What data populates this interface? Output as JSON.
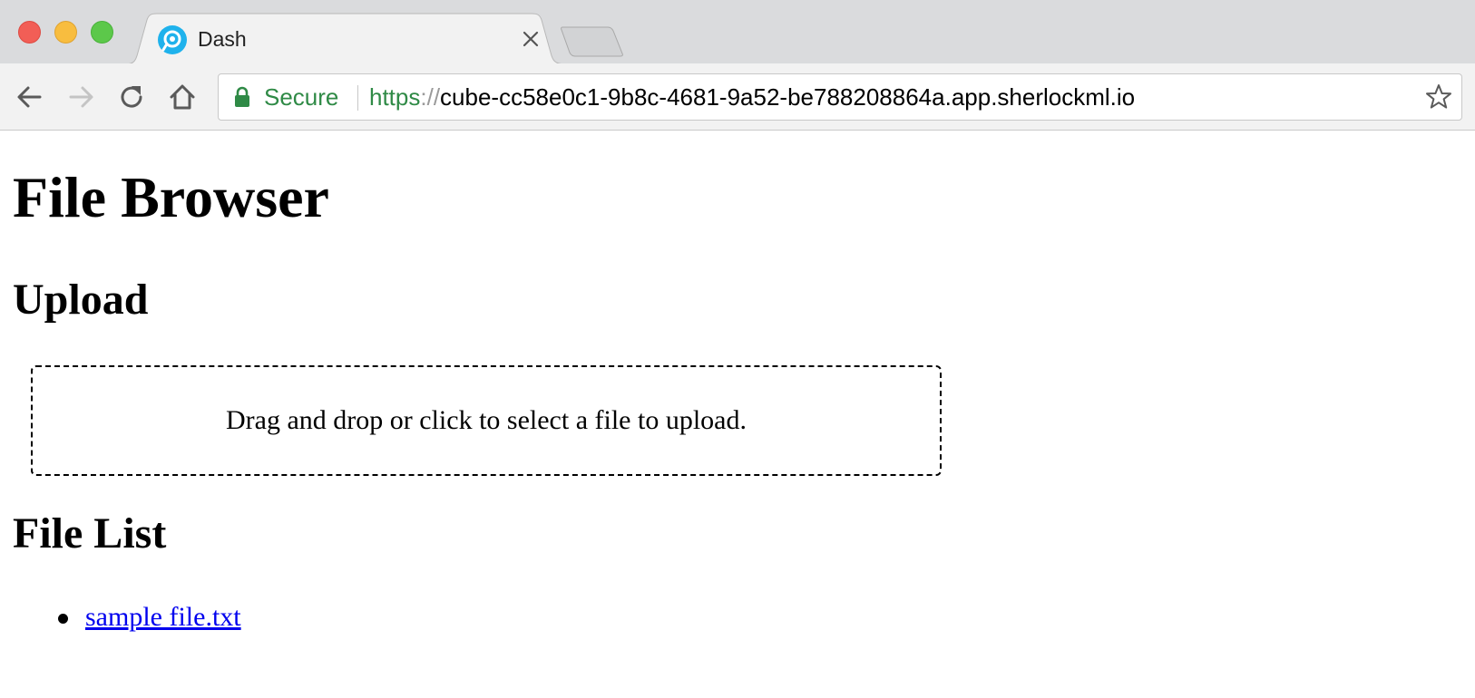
{
  "browser": {
    "tab": {
      "title": "Dash"
    },
    "address_bar": {
      "security_label": "Secure",
      "url_scheme": "https",
      "url_separator": "://",
      "url_host": "cube-cc58e0c1-9b8c-4681-9a52-be788208864a.app.sherlockml.io"
    },
    "colors": {
      "secure_green": "#2f8a46",
      "favicon_blue": "#1fb2ec"
    },
    "icons": [
      "back-arrow-icon",
      "forward-arrow-icon",
      "reload-icon",
      "home-icon",
      "lock-icon",
      "star-icon",
      "close-icon"
    ]
  },
  "page": {
    "title": "File Browser",
    "upload_heading": "Upload",
    "dropzone_text": "Drag and drop or click to select a file to upload.",
    "file_list_heading": "File List",
    "files": [
      {
        "name": "sample file.txt"
      }
    ],
    "colors": {
      "link": "#0000ee"
    }
  }
}
